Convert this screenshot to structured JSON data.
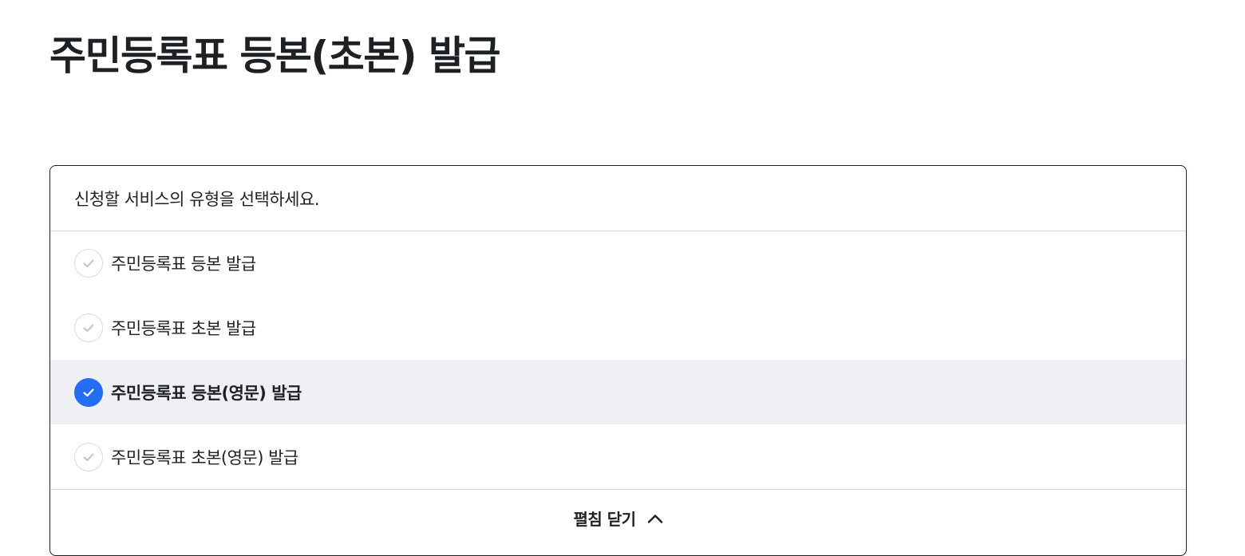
{
  "page": {
    "title": "주민등록표 등본(초본) 발급"
  },
  "service_select": {
    "prompt": "신청할 서비스의 유형을 선택하세요.",
    "options": [
      {
        "label": "주민등록표 등본 발급",
        "selected": false
      },
      {
        "label": "주민등록표 초본 발급",
        "selected": false
      },
      {
        "label": "주민등록표 등본(영문) 발급",
        "selected": true
      },
      {
        "label": "주민등록표 초본(영문) 발급",
        "selected": false
      }
    ],
    "toggle_label": "펼침 닫기",
    "toggle_icon": "chevron-up-icon"
  },
  "colors": {
    "accent": "#256ef4",
    "selected_row_bg": "#eef0f4",
    "text": "#1e2124",
    "divider": "#d6d9dd"
  }
}
